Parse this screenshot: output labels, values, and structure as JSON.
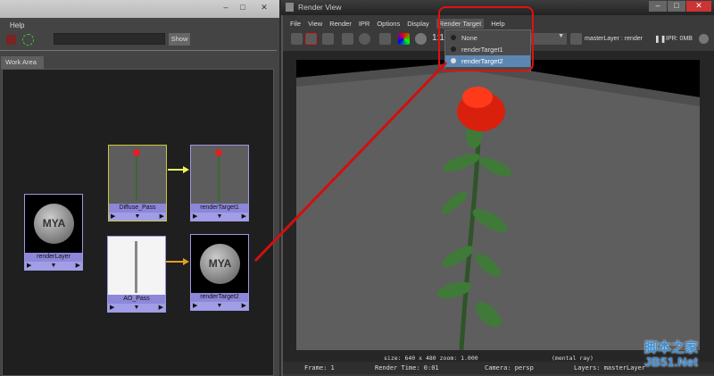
{
  "hypershade": {
    "menu": [
      "Help"
    ],
    "show_label": "Show",
    "search_value": "",
    "tab": "Work Area",
    "nodes": [
      {
        "label": "renderLayer"
      },
      {
        "label": "Diffuse_Pass"
      },
      {
        "label": "renderTarget1"
      },
      {
        "label": "AO_Pass"
      },
      {
        "label": "renderTarget2"
      }
    ],
    "node_buttons": [
      "▶",
      "▼",
      "▶"
    ]
  },
  "render_view": {
    "title": "Render View",
    "menu": [
      "File",
      "View",
      "Render",
      "IPR",
      "Options",
      "Display",
      "Render Target",
      "Help"
    ],
    "zoom_label": "1:1",
    "layer_label": "masterLayer : render",
    "ipr_label": "IPR: 0MB",
    "render_target_menu": {
      "options": [
        "None",
        "renderTarget1",
        "renderTarget2"
      ],
      "selected": "renderTarget2"
    },
    "info_line": "size: 640 x 480 zoom: 1.000",
    "renderer": "(mental ray)",
    "status": {
      "frame": "Frame: 1",
      "render_time": "Render Time: 0:01",
      "camera": "Camera: persp",
      "layers": "Layers: masterLayer"
    }
  },
  "watermark": {
    "line1": "脚本之家",
    "line2": "JB51.Net"
  },
  "colors": {
    "node": "#7d78c9",
    "highlight": "#e01010",
    "selected": "#5c87b2"
  }
}
